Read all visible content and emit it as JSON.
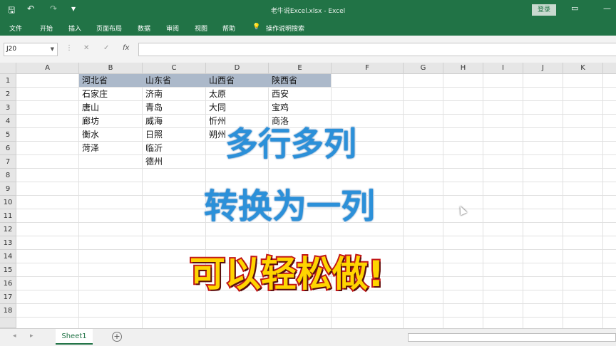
{
  "titlebar": {
    "save_icon": "save-icon",
    "undo": "↶",
    "redo": "↷",
    "customize": "▾",
    "document_title": "老牛说Excel.xlsx  -  Excel",
    "login": "登录",
    "ribbon_display": "▭",
    "minimize": "—"
  },
  "ribbon": {
    "tabs": [
      "文件",
      "开始",
      "插入",
      "页面布局",
      "数据",
      "审阅",
      "视图",
      "帮助"
    ],
    "search_label": "操作说明搜索"
  },
  "formula_bar": {
    "name_box": "J20",
    "cancel": "✕",
    "enter": "✓",
    "fx": "fx",
    "value": ""
  },
  "columns": [
    "A",
    "B",
    "C",
    "D",
    "E",
    "F",
    "G",
    "H",
    "I",
    "J",
    "K"
  ],
  "rows": [
    "1",
    "2",
    "3",
    "4",
    "5",
    "6",
    "7",
    "8",
    "9",
    "10",
    "11",
    "12",
    "13",
    "14",
    "15",
    "16",
    "17",
    "18"
  ],
  "table": {
    "headers": [
      "河北省",
      "山东省",
      "山西省",
      "陕西省"
    ],
    "col_b": [
      "石家庄",
      "唐山",
      "廊坊",
      "衡水",
      "菏泽"
    ],
    "col_c": [
      "济南",
      "青岛",
      "威海",
      "日照",
      "临沂",
      "德州"
    ],
    "col_d": [
      "太原",
      "大同",
      "忻州",
      "朔州"
    ],
    "col_e": [
      "西安",
      "宝鸡",
      "商洛"
    ]
  },
  "overlay": {
    "line1": "多行多列",
    "line2": "转换为一列",
    "line3": "可以轻松做!"
  },
  "sheet": {
    "tab": "Sheet1",
    "add": "+",
    "prev": "◂",
    "next": "▸"
  },
  "colors": {
    "accent": "#217346",
    "header_band": "#acb9ca",
    "overlay_blue": "#2b90d9",
    "overlay_yellow": "#ffd500",
    "overlay_red": "#c21818"
  }
}
